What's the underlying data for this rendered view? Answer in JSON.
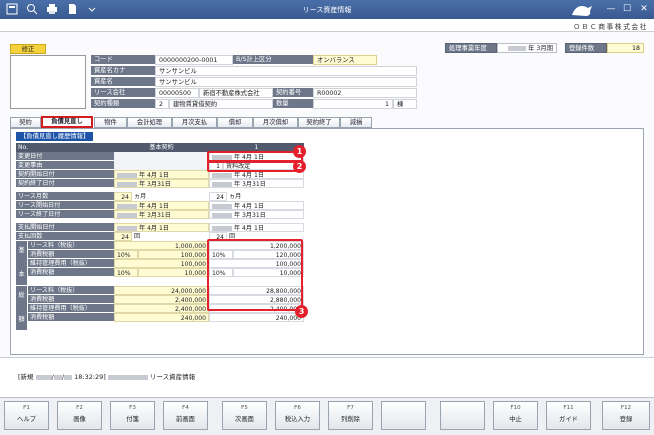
{
  "window": {
    "title": "リース資産情報",
    "company": "ＯＢＣ商事株式会社"
  },
  "header": {
    "badge": "修正",
    "fiscal_year_label": "処理事業年度",
    "fiscal_year_value": "年 3月期",
    "reg_count_label": "登録件数",
    "reg_count_value": "18"
  },
  "asset": {
    "code_label": "コード",
    "code_value": "0000000200-0001",
    "bs_label": "B/S計上区分",
    "bs_value": "オンバランス",
    "kana_label": "資産名カナ",
    "kana_value": "サンサンビル",
    "name_label": "資産名",
    "name_value": "サンサンビル",
    "lessor_label": "リース会社",
    "lessor_code": "00000500",
    "lessor_name": "新宿不動産株式会社",
    "contract_no_label": "契約番号",
    "contract_no_value": "R00002",
    "type_label": "契約種類",
    "type_code": "2",
    "type_name": "建物賃貸借契約",
    "qty_label": "数量",
    "qty_value": "1",
    "qty_unit": "棟"
  },
  "tabs": [
    "契約",
    "負債見直し",
    "物件",
    "会計処理",
    "月次支払",
    "償却",
    "月次償却",
    "契約終了",
    "減損"
  ],
  "active_tab": 1,
  "section_title": "【負債見直し履歴情報】",
  "table": {
    "no_label": "No.",
    "col_base": "基本契約",
    "col_1": "1",
    "change_date_label": "変更日付",
    "change_date_value": "年 4月 1日",
    "change_reason_label": "変更事由",
    "change_reason_code": "1",
    "change_reason_value": "賃料改定",
    "start_label": "契約開始日付",
    "start_base": "年 4月 1日",
    "start_1": "年 4月 1日",
    "end_label": "契約終了日付",
    "end_base": "年 3月31日",
    "end_1": "年 3月31日",
    "months_label": "リース月数",
    "months_base": "24",
    "months_1": "24",
    "months_unit": "ヵ月",
    "lease_start_label": "リース開始日付",
    "lease_start_base": "年 4月 1日",
    "lease_start_1": "年 4月 1日",
    "lease_end_label": "リース終了日付",
    "lease_end_base": "年 3月31日",
    "lease_end_1": "年 3月31日",
    "pay_start_label": "支払開始日付",
    "pay_start_base": "年 4月 1日",
    "pay_start_1": "年 4月 1日",
    "pay_count_label": "支払回数",
    "pay_count_base": "24",
    "pay_count_1": "24",
    "pay_count_unit": "回",
    "group_basic_1": "基",
    "group_basic_2": "本",
    "group_total_1": "総",
    "group_total_2": "額",
    "fee_label": "リース料（税抜）",
    "fee_base": "1,000,000",
    "fee_1": "1,200,000",
    "tax_label": "消費税額",
    "tax_rate_base": "10%",
    "tax_base": "100,000",
    "tax_rate_1": "10%",
    "tax_1": "120,000",
    "maint_label": "維持管理費用（税抜）",
    "maint_base": "100,000",
    "maint_1": "100,000",
    "mtax_label": "消費税額",
    "mtax_rate_base": "10%",
    "mtax_base": "10,000",
    "mtax_rate_1": "10%",
    "mtax_1": "10,000",
    "t_fee_label": "リース料（税抜）",
    "t_fee_base": "24,000,000",
    "t_fee_1": "28,800,000",
    "t_tax_label": "消費税額",
    "t_tax_base": "2,400,000",
    "t_tax_1": "2,880,000",
    "t_maint_label": "維持管理費用（税抜）",
    "t_maint_base": "2,400,000",
    "t_maint_1": "2,400,000",
    "t_mtax_label": "消費税額",
    "t_mtax_base": "240,000",
    "t_mtax_1": "240,000"
  },
  "callouts": [
    "1",
    "2",
    "3"
  ],
  "status": {
    "prefix": "[新規",
    "date_sep": "/",
    "time": "18:32:29]",
    "module": "リース資産情報"
  },
  "fkeys": [
    {
      "num": "F1",
      "label": "ヘルプ"
    },
    {
      "num": "F2",
      "label": "画像"
    },
    {
      "num": "F3",
      "label": "付箋"
    },
    {
      "num": "F4",
      "label": "前画面"
    },
    {
      "num": "F5",
      "label": "次画面"
    },
    {
      "num": "F6",
      "label": "税込入力"
    },
    {
      "num": "F7",
      "label": "列削除"
    },
    {
      "num": "",
      "label": ""
    },
    {
      "num": "",
      "label": ""
    },
    {
      "num": "F10",
      "label": "中止"
    },
    {
      "num": "F11",
      "label": "ガイド"
    },
    {
      "num": "F12",
      "label": "登録"
    }
  ],
  "colors": {
    "titlebar": "#4a6fa8",
    "label_bg": "#6d7789",
    "section": "#1d54a8",
    "input_yellow": "#fffbd2",
    "callout": "#e3202c"
  }
}
